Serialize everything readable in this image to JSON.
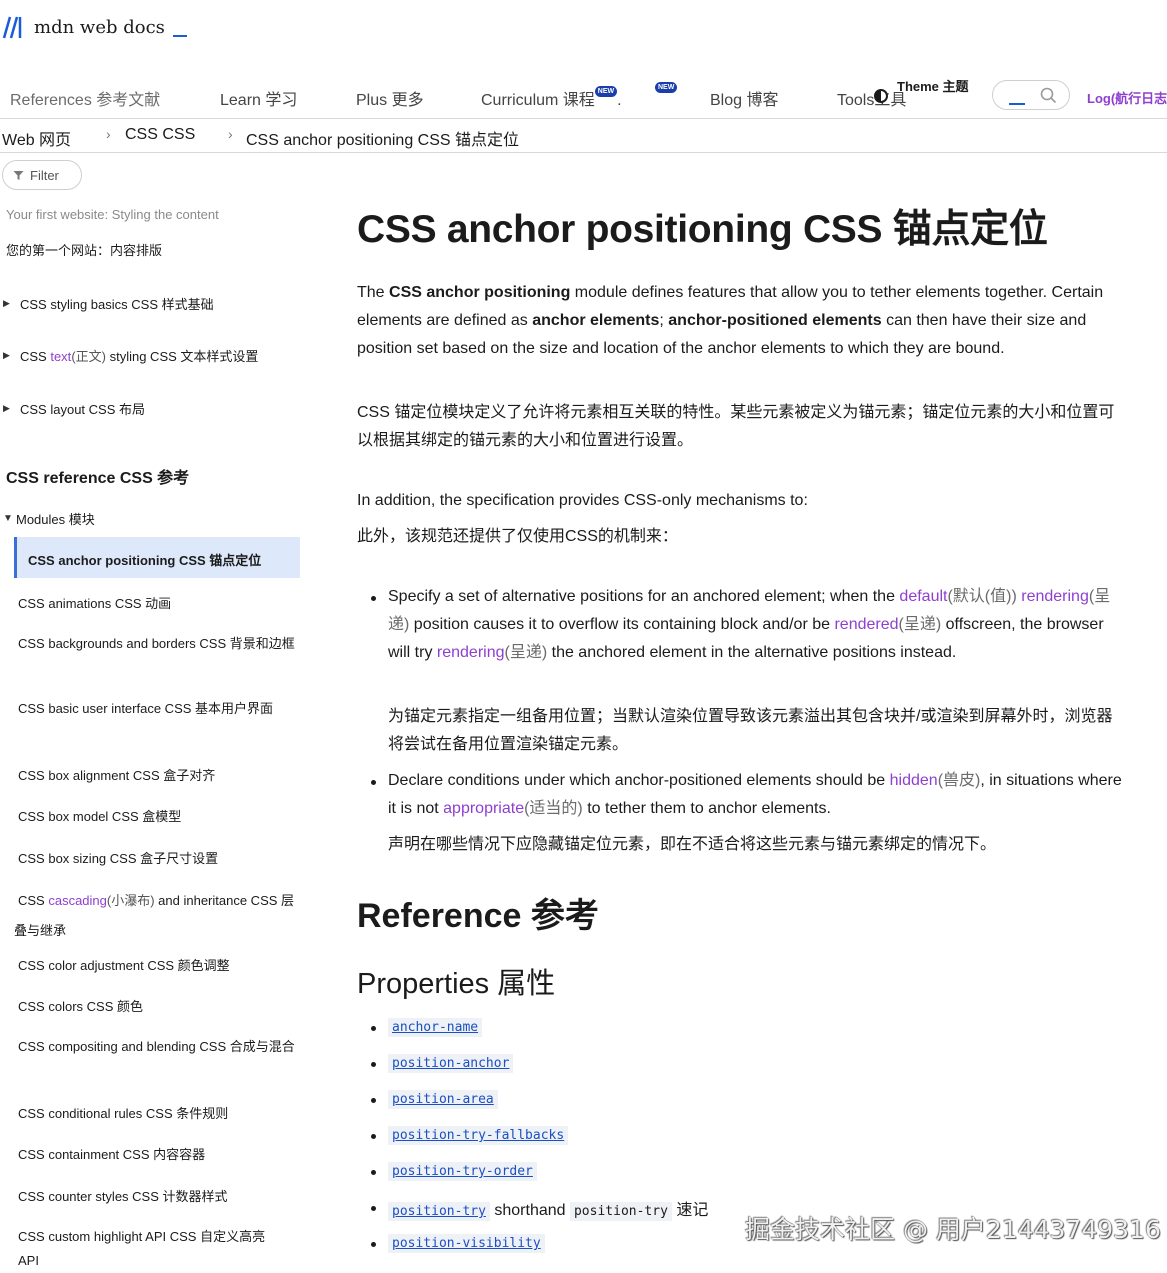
{
  "header": {
    "logo_text": "mdn web docs",
    "nav": [
      {
        "label": "References 参考文献"
      },
      {
        "label": "Learn 学习"
      },
      {
        "label": "Plus 更多"
      },
      {
        "label": "Curriculum  课程"
      },
      {
        "label": "Blog 博客"
      },
      {
        "label": "Tools工具"
      }
    ],
    "new_badge": "NEW",
    "theme_label": "Theme 主题",
    "login_label": "Log(航行日志"
  },
  "breadcrumbs": [
    "Web 网页",
    "CSS CSS",
    "CSS anchor positioning CSS 锚点定位"
  ],
  "sidebar": {
    "filter_label": "Filter",
    "intro_en": "Your first website: Styling the content",
    "intro_zh": "您的第一个网站：内容排版",
    "collapsed": [
      {
        "label": "CSS styling basics CSS 样式基础"
      },
      {
        "pre": "CSS ",
        "link": "text",
        "zh": "(正文)",
        "post": " styling  CSS 文本样式设置"
      },
      {
        "label": "CSS layout CSS 布局"
      }
    ],
    "heading": "CSS reference CSS 参考",
    "modules_label": "Modules 模块",
    "active": "CSS anchor positioning CSS 锚点定位",
    "items": [
      {
        "label": "CSS animations CSS 动画"
      },
      {
        "label": "CSS backgrounds and borders CSS 背景和边框"
      },
      {
        "label": "CSS basic user interface CSS 基本用户界面"
      },
      {
        "label": "CSS box alignment CSS 盒子对齐"
      },
      {
        "label": "CSS box model CSS 盒模型"
      },
      {
        "label": "CSS box sizing CSS 盒子尺寸设置"
      },
      {
        "pre": "CSS ",
        "link": "cascading",
        "zh": "(小瀑布)",
        "post": " and inheritance  CSS 层叠与继承"
      },
      {
        "label": "CSS color adjustment CSS 颜色调整"
      },
      {
        "label": "CSS colors CSS 颜色"
      },
      {
        "label": "CSS compositing and blending CSS 合成与混合"
      },
      {
        "label": "CSS conditional rules CSS 条件规则"
      },
      {
        "label": "CSS containment CSS 内容容器"
      },
      {
        "label": "CSS counter styles CSS 计数器样式"
      },
      {
        "label": "CSS custom highlight API CSS 自定义高亮 API"
      }
    ]
  },
  "main": {
    "title": "CSS anchor positioning CSS 锚点定位",
    "intro": {
      "t1": "The ",
      "b1": "CSS anchor positioning",
      "t2": " module defines features that allow you to tether elements together. Certain elements are defined as ",
      "b2": "anchor elements",
      "t3": "; ",
      "b3": "anchor-positioned elements",
      "t4": " can then have their size and position set based on the size and location of the anchor elements to which they are bound."
    },
    "intro_zh": "CSS 锚定位模块定义了允许将元素相互关联的特性。某些元素被定义为锚元素；锚定位元素的大小和位置可以根据其绑定的锚元素的大小和位置进行设置。",
    "addition_en": "In addition, the specification provides CSS-only mechanisms to:",
    "addition_zh": "此外，该规范还提供了仅使用CSS的机制来：",
    "bullet1": {
      "t1": "Specify a set of alternative positions for an anchored element; when the ",
      "l1": "default",
      "z1": "(默认(值))",
      "l2": "rendering",
      "z2": "(呈递)",
      "t2": " position causes it to overflow its containing block and/or be ",
      "l3": "rendered",
      "z3": "(呈递)",
      "t3": " offscreen, the browser will try ",
      "l4": "rendering",
      "z4": "(呈递)",
      "t4": " the anchored element in the alternative positions instead."
    },
    "bullet1_zh": "为锚定元素指定一组备用位置；当默认渲染位置导致该元素溢出其包含块并/或渲染到屏幕外时，浏览器将尝试在备用位置渲染锚定元素。",
    "bullet2": {
      "t1": "Declare conditions under which anchor-positioned elements should be ",
      "l1": "hidden",
      "z1": "(兽皮)",
      "t2": ", in situations where it is not ",
      "l2": "appropriate",
      "z2": "(适当的)",
      "t3": " to tether them to anchor elements."
    },
    "bullet2_zh": "声明在哪些情况下应隐藏锚定位元素，即在不适合将这些元素与锚元素绑定的情况下。",
    "reference_heading": "Reference 参考",
    "properties_heading": "Properties 属性",
    "properties": [
      "anchor-name",
      "position-anchor",
      "position-area",
      "position-try-fallbacks",
      "position-try-order",
      "position-try",
      "position-visibility"
    ],
    "shorthand_text": " shorthand ",
    "shorthand_code": "position-try",
    "shorthand_zh": " 速记"
  },
  "watermark": "掘金技术社区 @ 用户21443749316",
  "colors": {
    "link": "#8e3fd0",
    "code_link": "#1b4fc4",
    "active_bg": "#dde9fb",
    "brand": "#1a5bd8"
  }
}
